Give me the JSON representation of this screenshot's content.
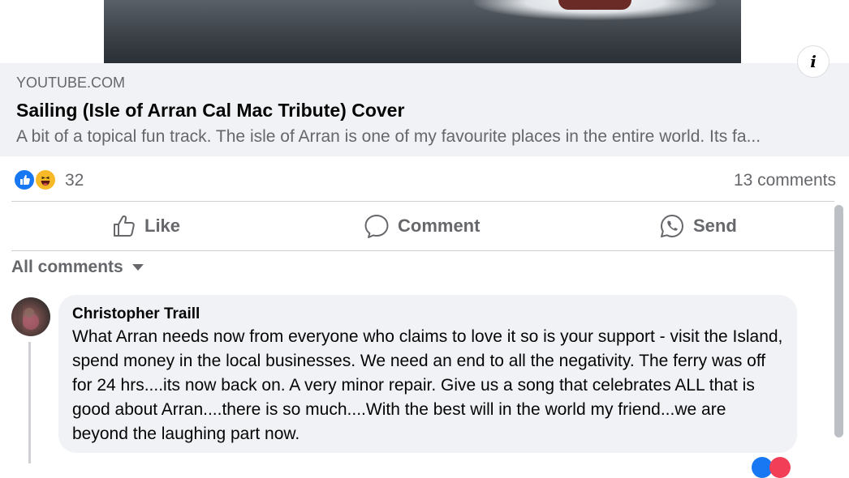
{
  "link_preview": {
    "domain": "YOUTUBE.COM",
    "title": "Sailing (Isle of Arran Cal Mac Tribute) Cover",
    "description": "A bit of a topical fun track. The isle of Arran is one of my favourite places in the entire world. Its fa...",
    "info_icon": "info-icon"
  },
  "reactions": {
    "icons": [
      "like-reaction-icon",
      "haha-reaction-icon"
    ],
    "count": "32",
    "comments_count": "13 comments"
  },
  "actions": {
    "like": "Like",
    "comment": "Comment",
    "send": "Send"
  },
  "comments_filter": {
    "label": "All comments",
    "icon": "caret-down-icon"
  },
  "comment": {
    "author": "Christopher Traill",
    "text": "What Arran needs now from everyone who claims to love it so is your support - visit the Island, spend money in the local businesses. We need an end to all the negativity. The ferry was off for 24 hrs....its now back on. A very minor repair. Give us a song that celebrates ALL that is good about Arran....there is so much....With the best will in the world my friend...we are beyond the laughing part now."
  },
  "colors": {
    "accent": "#1877f2",
    "secondary_text": "#65676b",
    "bubble": "#f0f2f5"
  }
}
